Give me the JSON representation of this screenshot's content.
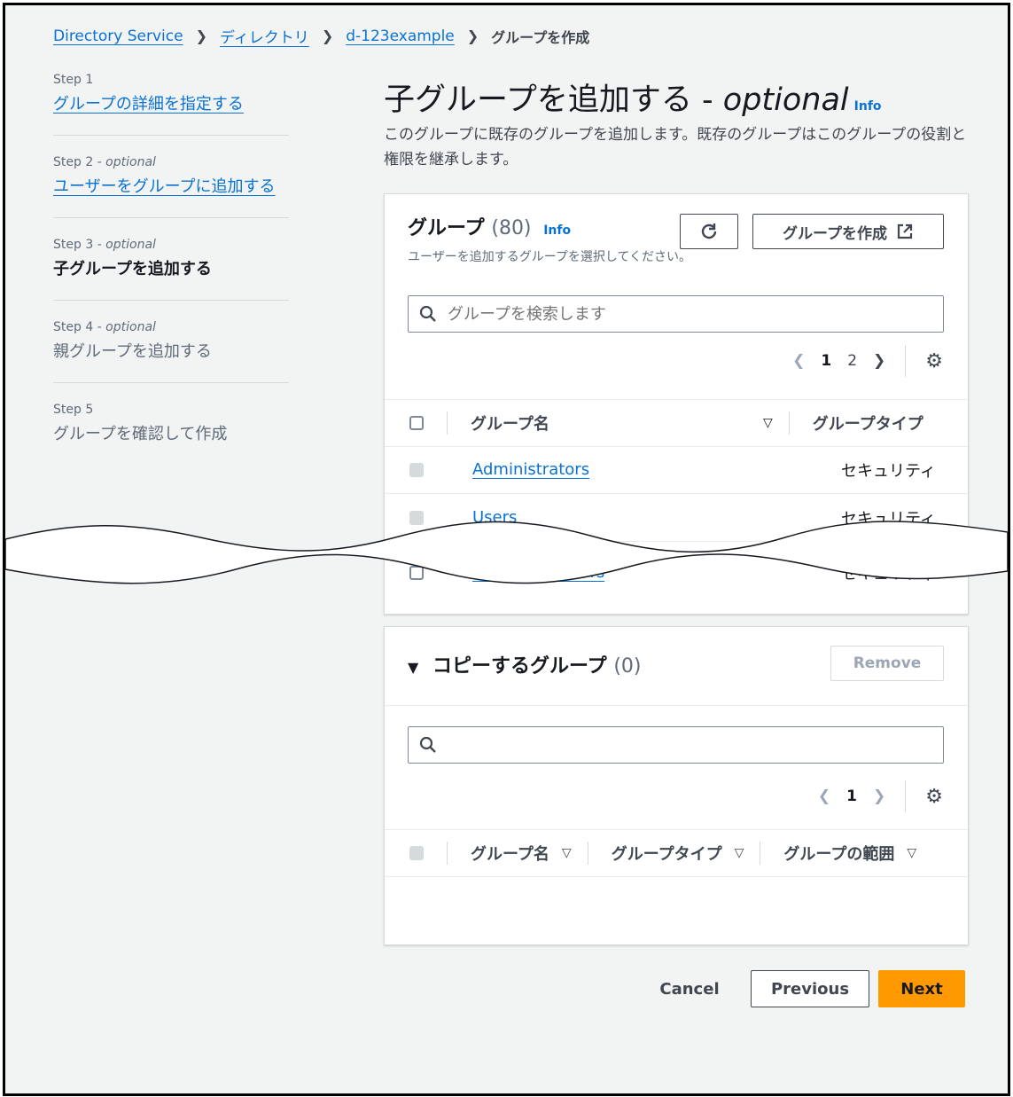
{
  "breadcrumb": {
    "items": [
      "Directory Service",
      "ディレクトリ",
      "d-123example"
    ],
    "current": "グループを作成"
  },
  "steps": [
    {
      "num": "Step 1",
      "optional": "",
      "title": "グループの詳細を指定する",
      "state": "link"
    },
    {
      "num": "Step 2",
      "optional": " - optional",
      "title": "ユーザーをグループに追加する",
      "state": "link"
    },
    {
      "num": "Step 3",
      "optional": " - optional",
      "title": "子グループを追加する",
      "state": "active"
    },
    {
      "num": "Step 4",
      "optional": " - optional",
      "title": "親グループを追加する",
      "state": "disabled"
    },
    {
      "num": "Step 5",
      "optional": "",
      "title": "グループを確認して作成",
      "state": "disabled"
    }
  ],
  "page": {
    "title": "子グループを追加する - ",
    "title_optional": "optional",
    "info": "Info",
    "description": "このグループに既存のグループを追加します。既存のグループはこのグループの役割と権限を継承します。"
  },
  "groups_panel": {
    "title": "グループ",
    "count": "(80)",
    "info": "Info",
    "subtitle": "ユーザーを追加するグループを選択してください。",
    "create_button": "グループを作成",
    "search_placeholder": "グループを検索します",
    "pages": [
      "1",
      "2"
    ],
    "columns": [
      "グループ名",
      "グループタイプ"
    ],
    "rows": [
      {
        "name": "Administrators",
        "type": "セキュリティ"
      },
      {
        "name": "Users",
        "type": "セキュリティ"
      },
      {
        "name": "...Administrators",
        "type": "セキュリティ"
      }
    ]
  },
  "copy_panel": {
    "title": "コピーするグループ",
    "count": "(0)",
    "remove_button": "Remove",
    "search_placeholder": "",
    "current_page": "1",
    "columns": [
      "グループ名",
      "グループタイプ",
      "グループの範囲"
    ]
  },
  "footer": {
    "cancel": "Cancel",
    "previous": "Previous",
    "next": "Next"
  },
  "colors": {
    "link": "#0972d3",
    "primary": "#ff9900",
    "background": "#f2f3f3"
  }
}
